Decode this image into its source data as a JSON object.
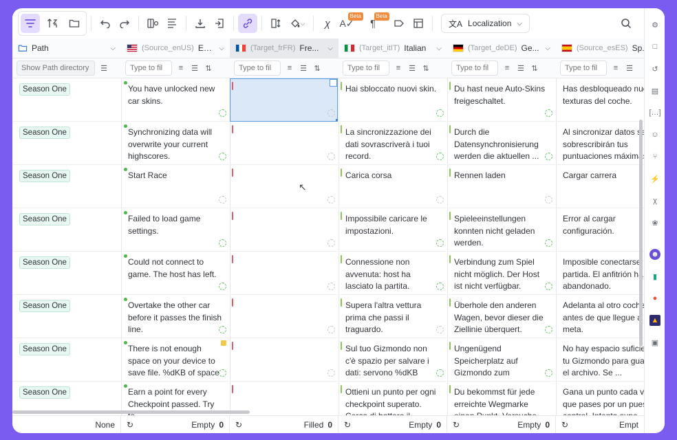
{
  "toolbar": {
    "localization_label": "Localization",
    "beta": "Beta"
  },
  "columns": [
    {
      "code": "",
      "name": "Path"
    },
    {
      "code": "(Source_enUS)",
      "name": "En..."
    },
    {
      "code": "(Target_frFR)",
      "name": "Fre..."
    },
    {
      "code": "(Target_itIT)",
      "name": "Italian"
    },
    {
      "code": "(Target_deDE)",
      "name": "Ge..."
    },
    {
      "code": "(Source_esES)",
      "name": "Sp..."
    }
  ],
  "filters": {
    "path_placeholder": "Show Path directory",
    "text_placeholder": "Type to fil"
  },
  "rows": [
    {
      "path": "Season One",
      "en": "You have unlocked new car skins.",
      "fr": "",
      "it": "Hai sbloccato nuovi skin.",
      "de": "Du hast neue Auto-Skins freigeschaltet.",
      "es": "Has desbloqueado nuev texturas del coche."
    },
    {
      "path": "Season One",
      "en": "Synchronizing data will overwrite your current highscores.",
      "fr": "",
      "it": "La sincronizzazione dei dati sovrascriverà i tuoi record.",
      "de": "Durch die Datensynchronisierung werden die aktuellen ...",
      "es": "Al sincronizar datos se sobrescribirán tus puntuaciones máximas"
    },
    {
      "path": "Season One",
      "en": "Start Race",
      "fr": "",
      "it": "Carica corsa",
      "de": "Rennen laden",
      "es": "Cargar carrera"
    },
    {
      "path": "Season One",
      "en": "Failed to load game settings.",
      "fr": "",
      "it": "Impossibile caricare le impostazioni.",
      "de": "Spieleeinstellungen konnten nicht geladen werden.",
      "es": "Error al cargar configuración."
    },
    {
      "path": "Season One",
      "en": "Could not connect to game. The host has left.",
      "fr": "",
      "it": "Connessione non avvenuta: host ha lasciato la partita.",
      "de": "Verbindung zum Spiel nicht möglich. Der Host ist nicht verfügbar.",
      "es": "Imposible conectarse partida. El anfitrión ha abandonado."
    },
    {
      "path": "Season One",
      "en": "Overtake the other car before it passes the finish line.",
      "fr": "",
      "it": "Supera l'altra vettura prima che passi il traguardo.",
      "de": "Überhole den anderen Wagen, bevor dieser die Ziellinie überquert.",
      "es": "Adelanta al otro coche antes de que llegue a la meta."
    },
    {
      "path": "Season One",
      "en": "There is not enough space on your device to save file. %dKB of space needed.",
      "fr": "",
      "it": "Sul tuo Gizmondo non c'è spazio per salvare i dati: servono %dKB liberi.",
      "de": "Ungenügend Speicherplatz auf Gizmondo zum Speichern der Datei. Es ...",
      "es": "No hay espacio suficien en tu Gizmondo para guardar el archivo. Se ..."
    },
    {
      "path": "Season One",
      "en": "Earn a point for every Checkpoint passed. Try to",
      "fr": "",
      "it": "Ottieni un punto per ogni checkpoint superato. Cerca di battere il punteggio",
      "de": "Du bekommst für jede erreichte Wegmarke einen Punkt. Versuche, die",
      "es": "Gana un punto cada vez que pases por un puest de control. Intenta supe"
    }
  ],
  "footer": [
    {
      "left": "",
      "right_label": "None",
      "count": ""
    },
    {
      "left": "",
      "right_label": "Empty",
      "count": "0"
    },
    {
      "left": "",
      "right_label": "Filled",
      "count": "0"
    },
    {
      "left": "",
      "right_label": "Empty",
      "count": "0"
    },
    {
      "left": "",
      "right_label": "Empty",
      "count": "0"
    },
    {
      "left": "",
      "right_label": "Empt",
      "count": ""
    }
  ],
  "colors": {
    "accent": "#7b5cf0",
    "selected_cell": "#dbe8f7",
    "tag_bg": "#e8f7f1"
  }
}
